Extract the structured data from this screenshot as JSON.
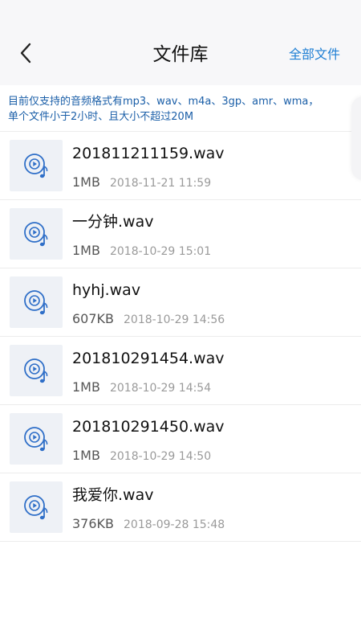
{
  "header": {
    "title": "文件库",
    "all_files_label": "全部文件",
    "back_icon": "chevron-left-icon"
  },
  "notice": {
    "line1": "目前仅支持的音频格式有mp3、wav、m4a、3gp、amr、wma，",
    "line2": "单个文件小于2小时、且大小不超过20M"
  },
  "files": [
    {
      "name": "201811211159.wav",
      "size": "1MB",
      "date": "2018-11-21 11:59"
    },
    {
      "name": "一分钟.wav",
      "size": "1MB",
      "date": "2018-10-29 15:01"
    },
    {
      "name": "hyhj.wav",
      "size": "607KB",
      "date": "2018-10-29 14:56"
    },
    {
      "name": "201810291454.wav",
      "size": "1MB",
      "date": "2018-10-29 14:54"
    },
    {
      "name": "201810291450.wav",
      "size": "1MB",
      "date": "2018-10-29 14:50"
    },
    {
      "name": "我爱你.wav",
      "size": "376KB",
      "date": "2018-09-28 15:48"
    }
  ],
  "colors": {
    "accent": "#1f7fd4",
    "notice_text": "#1b5fa8",
    "icon_blue": "#2f6fc8",
    "icon_bg": "#eef1f6"
  }
}
